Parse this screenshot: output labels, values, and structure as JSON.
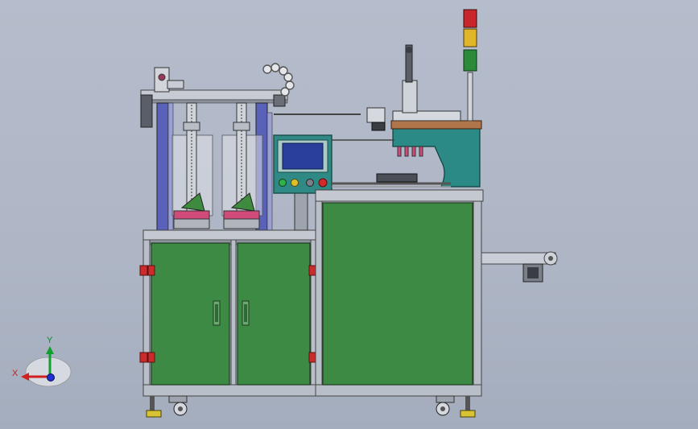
{
  "triad": {
    "x_label": "X",
    "y_label": "Y"
  },
  "colors": {
    "panel_green": "#3d8a45",
    "frame_gray": "#b9bfc8",
    "column_blue": "#5a61b8",
    "hmi_teal": "#2f8a85",
    "screen_blue": "#2a3f9c",
    "press_teal": "#2c8a86",
    "tower_red": "#c8262a",
    "tower_yellow": "#e0b52a",
    "tower_green": "#2b8b3b",
    "hinge_red": "#cc2b2b",
    "foot_yellow": "#d8c433",
    "axis_red": "#d02020",
    "axis_green": "#10a030",
    "axis_blue": "#2030d0"
  }
}
